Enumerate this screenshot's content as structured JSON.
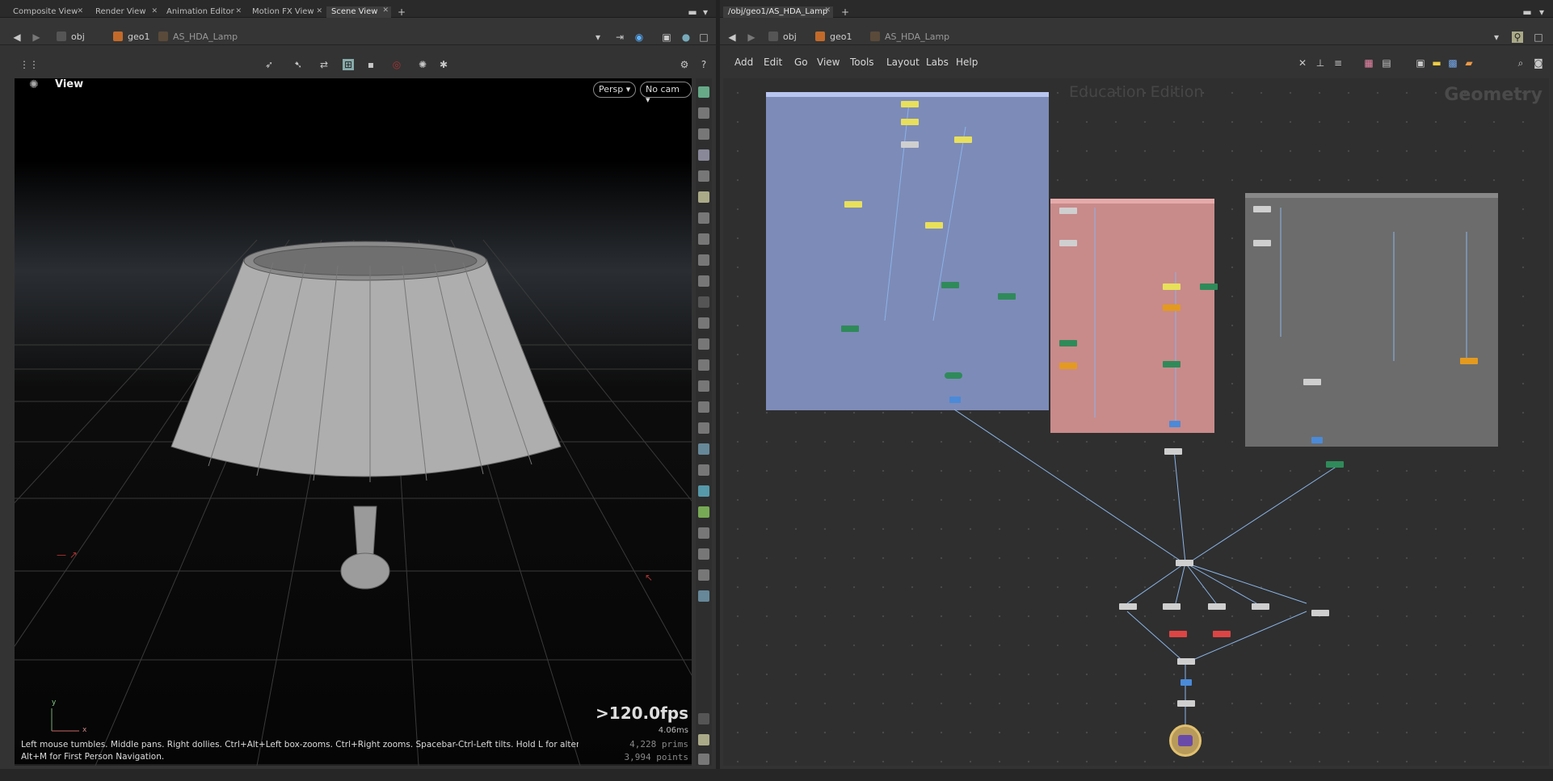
{
  "left_pane": {
    "tabs": [
      "Composite View",
      "Render View",
      "Animation Editor",
      "Motion FX View",
      "Scene View"
    ],
    "path": {
      "level1": "obj",
      "level2": "geo1",
      "level3": "AS_HDA_Lamp"
    },
    "viewport": {
      "title": "View",
      "persp_label": "Persp",
      "cam_label": "No cam",
      "fps": ">120.0fps",
      "ms": "4.06ms",
      "prims_line": "4,228  prims",
      "points_line": "3,994 points",
      "axis_y": "y",
      "axis_x": "x",
      "hint_line1": "Left mouse tumbles. Middle pans. Right dollies. Ctrl+Alt+Left box-zooms. Ctrl+Right zooms. Spacebar-Ctrl-Left tilts. Hold L for alternate tumble, dolly, and zoom.",
      "hint_line2": "Alt+M for First Person Navigation."
    }
  },
  "right_pane": {
    "tab": "/obj/geo1/AS_HDA_Lamp",
    "path": {
      "level1": "obj",
      "level2": "geo1",
      "level3": "AS_HDA_Lamp"
    },
    "menu": [
      "Add",
      "Edit",
      "Go",
      "View",
      "Tools",
      "Layout",
      "Labs",
      "Help"
    ],
    "watermark": "Education Edition",
    "context_label": "Geometry"
  },
  "colors": {
    "blue_box": "#7d8bb8",
    "red_box": "#c98a8a",
    "gray_box": "#6c6c6c"
  }
}
